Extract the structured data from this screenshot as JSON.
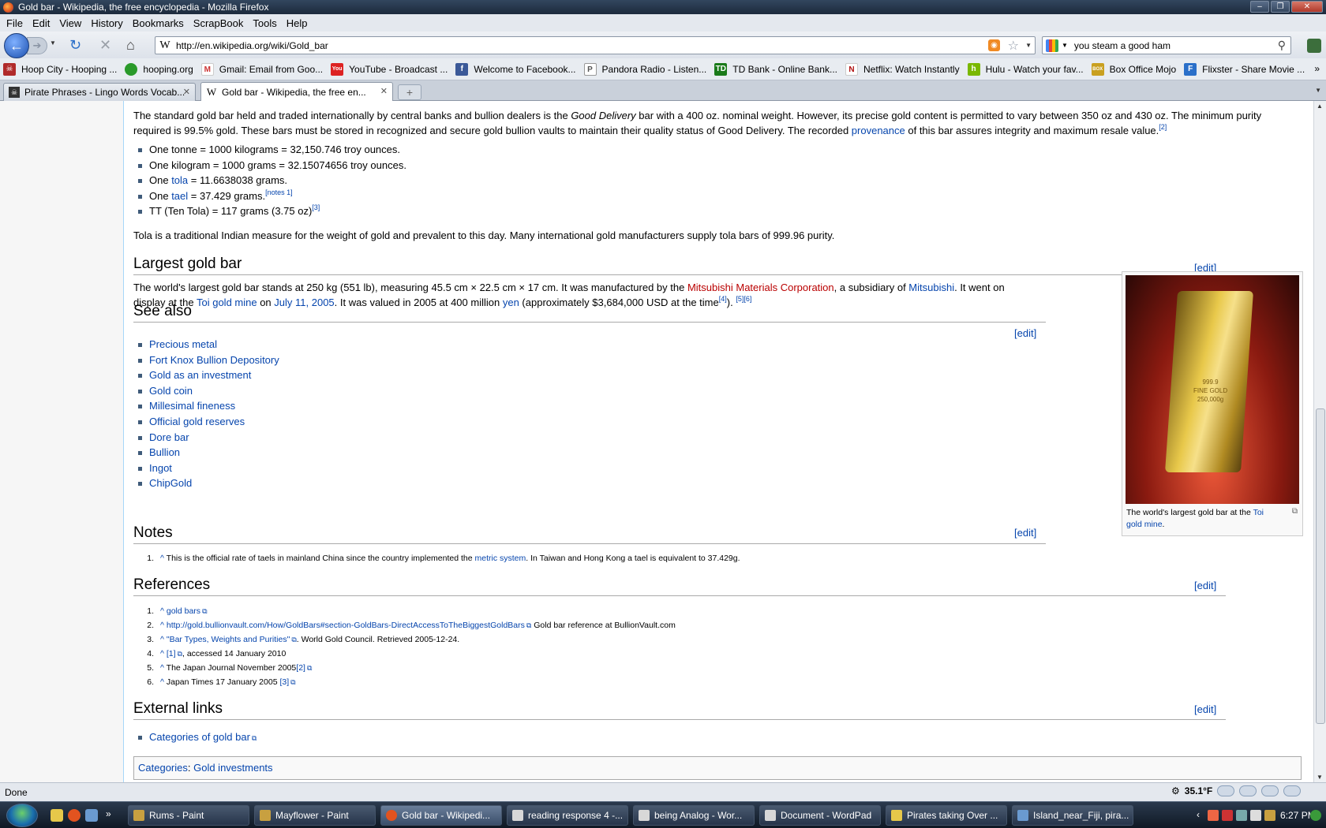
{
  "window": {
    "title": "Gold bar - Wikipedia, the free encyclopedia - Mozilla Firefox"
  },
  "menu": [
    "File",
    "Edit",
    "View",
    "History",
    "Bookmarks",
    "ScrapBook",
    "Tools",
    "Help"
  ],
  "url": "http://en.wikipedia.org/wiki/Gold_bar",
  "search": {
    "value": "you steam a good ham"
  },
  "bookmarks": [
    {
      "label": "Hoop City - Hooping ...",
      "color": "#b02a2a",
      "icon": "skull-icon"
    },
    {
      "label": "hooping.org",
      "color": "#2a9a2a",
      "icon": "globe-icon"
    },
    {
      "label": "Gmail: Email from Goo...",
      "color": "#c33",
      "icon": "gmail-icon"
    },
    {
      "label": "YouTube - Broadcast ...",
      "color": "#d22",
      "icon": "youtube-icon"
    },
    {
      "label": "Welcome to Facebook...",
      "color": "#3b5998",
      "icon": "facebook-icon"
    },
    {
      "label": "Pandora Radio - Listen...",
      "color": "#888",
      "icon": "pandora-icon"
    },
    {
      "label": "TD Bank - Online Bank...",
      "color": "#1a7a1a",
      "icon": "td-icon"
    },
    {
      "label": "Netflix: Watch Instantly",
      "color": "#b01010",
      "icon": "netflix-icon"
    },
    {
      "label": "Hulu - Watch your fav...",
      "color": "#7ab800",
      "icon": "hulu-icon"
    },
    {
      "label": "Box Office Mojo",
      "color": "#c9a020",
      "icon": "mojo-icon"
    },
    {
      "label": "Flixster - Share Movie ...",
      "color": "#2a6fc9",
      "icon": "flixster-icon"
    }
  ],
  "tabs": [
    {
      "label": "Pirate Phrases - Lingo Words Vocab..."
    },
    {
      "label": "Gold bar - Wikipedia, the free en..."
    }
  ],
  "article": {
    "intro_a": "The standard gold bar held and traded internationally by central banks and bullion dealers is the ",
    "intro_em": "Good Delivery",
    "intro_b": " bar with a 400 oz. nominal weight. However, its precise gold content is permitted to vary between 350 oz and 430 oz. The minimum purity required is 99.5% gold. These bars must be stored in recognized and secure gold bullion vaults to maintain their quality status of Good Delivery. The recorded ",
    "intro_link": "provenance",
    "intro_c": " of this bar assures integrity and maximum resale value.",
    "intro_ref": "[2]",
    "units": [
      {
        "a": "One tonne = 1000 kilograms = 32,150.746 troy ounces."
      },
      {
        "a": "One kilogram = 1000 grams = 32.15074656 troy ounces."
      },
      {
        "a": "One ",
        "link": "tola",
        "b": " = 11.6638038 grams."
      },
      {
        "a": "One ",
        "link": "tael",
        "b": " = 37.429 grams.",
        "sup": "[notes 1]"
      },
      {
        "a": "TT (Ten Tola) = 117 grams (3.75 oz)",
        "sup": "[3]"
      }
    ],
    "tola_text": "Tola is a traditional Indian measure for the weight of gold and prevalent to this day. Many international gold manufacturers supply tola bars of 999.96 purity.",
    "edit_label": "[edit]",
    "largest": {
      "heading": "Largest gold bar",
      "t1": "The world's largest gold bar stands at 250 kg (551 lb), measuring 45.5 cm × 22.5 cm × 17 cm. It was manufactured by the ",
      "l1": "Mitsubishi Materials Corporation",
      "t2": ", a subsidiary of ",
      "l2": "Mitsubishi",
      "t3": ". It went on display at the ",
      "l3": "Toi gold mine",
      "t4": " on ",
      "l4": "July 11, 2005",
      "t5": ". It was valued in 2005 at 400 million ",
      "l5": "yen",
      "t6": " (approximately $3,684,000 USD at the time",
      "s1": "[4]",
      "t7": "). ",
      "s2": "[5][6]"
    },
    "thumb": {
      "caption_a": "The world's largest gold bar at the ",
      "caption_link": "Toi gold mine",
      "caption_b": ".",
      "bar_text": "999.9\nFINE GOLD\n250,000g"
    },
    "see_also": {
      "heading": "See also",
      "items": [
        "Precious metal",
        "Fort Knox Bullion Depository",
        "Gold as an investment",
        "Gold coin",
        "Millesimal fineness",
        "Official gold reserves",
        "Dore bar",
        "Bullion",
        "Ingot",
        "ChipGold"
      ]
    },
    "notes": {
      "heading": "Notes",
      "n": "1.",
      "caret": "^",
      "a": " This is the official rate of taels in mainland China since the country implemented the ",
      "link": "metric system",
      "b": ". In Taiwan and Hong Kong a tael is equivalent to 37.429g."
    },
    "references": {
      "heading": "References",
      "items": [
        {
          "n": "1.",
          "caret": "^",
          "link": "gold bars",
          "text": ""
        },
        {
          "n": "2.",
          "caret": "^",
          "link": "http://gold.bullionvault.com/How/GoldBars#section-GoldBars-DirectAccessToTheBiggestGoldBars",
          "text": " Gold bar reference at BullionVault.com"
        },
        {
          "n": "3.",
          "caret": "^",
          "link": "\"Bar Types, Weights and Purities\"",
          "text": ". World Gold Council. Retrieved 2005-12-24."
        },
        {
          "n": "4.",
          "caret": "^",
          "link": "[1]",
          "text": ", accessed 14 January 2010"
        },
        {
          "n": "5.",
          "caret": "^",
          "pre": " The Japan Journal November 2005",
          "link": "[2]",
          "text": ""
        },
        {
          "n": "6.",
          "caret": "^",
          "pre": " Japan Times 17 January 2005 ",
          "link": "[3]",
          "text": ""
        }
      ]
    },
    "external": {
      "heading": "External links",
      "items": [
        "Categories of gold bar"
      ]
    },
    "categories": {
      "label": "Categories",
      "sep": ": ",
      "items": [
        "Gold investments"
      ]
    }
  },
  "status": {
    "text": "Done",
    "temp": "35.1°F"
  },
  "taskbar": {
    "items": [
      {
        "label": "Rums - Paint",
        "color": "#c8a040"
      },
      {
        "label": "Mayflower - Paint",
        "color": "#c8a040"
      },
      {
        "label": "Gold bar - Wikipedi...",
        "color": "#e2531f"
      },
      {
        "label": "reading response 4 -...",
        "color": "#d8d8d8"
      },
      {
        "label": "being Analog - Wor...",
        "color": "#d8d8d8"
      },
      {
        "label": "Document - WordPad",
        "color": "#d8d8d8"
      },
      {
        "label": "Pirates taking Over ...",
        "color": "#e6c84a"
      },
      {
        "label": "Island_near_Fiji, pira...",
        "color": "#6a9ad0"
      }
    ],
    "clock": "6:27 PM"
  }
}
